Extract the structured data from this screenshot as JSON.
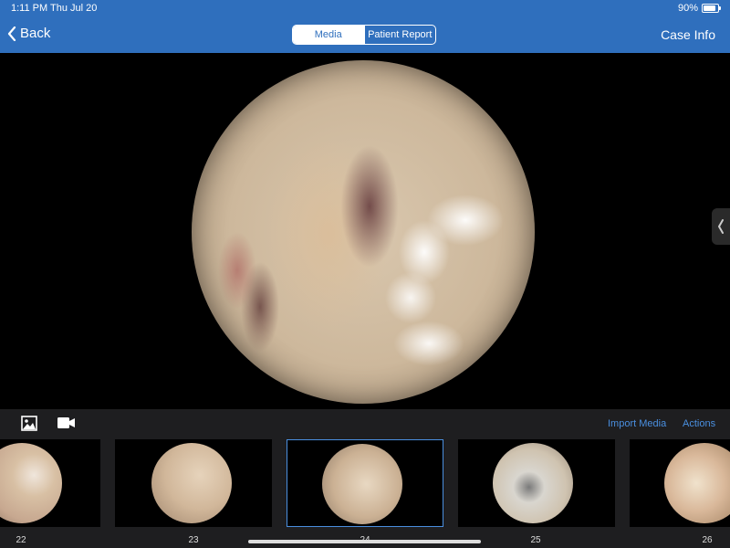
{
  "status": {
    "time": "1:11 PM",
    "date": "Thu Jul 20",
    "battery": "90%"
  },
  "nav": {
    "back_label": "Back",
    "segments": {
      "media": "Media",
      "report": "Patient Report"
    },
    "case_info": "Case Info"
  },
  "toolbar": {
    "import_media": "Import Media",
    "actions": "Actions"
  },
  "thumbnails": [
    {
      "label": "22"
    },
    {
      "label": "23"
    },
    {
      "label": "24"
    },
    {
      "label": "25"
    },
    {
      "label": "26"
    }
  ],
  "colors": {
    "header": "#2f6fbd",
    "accent": "#4a8fe0",
    "panel": "#1e1e20"
  }
}
